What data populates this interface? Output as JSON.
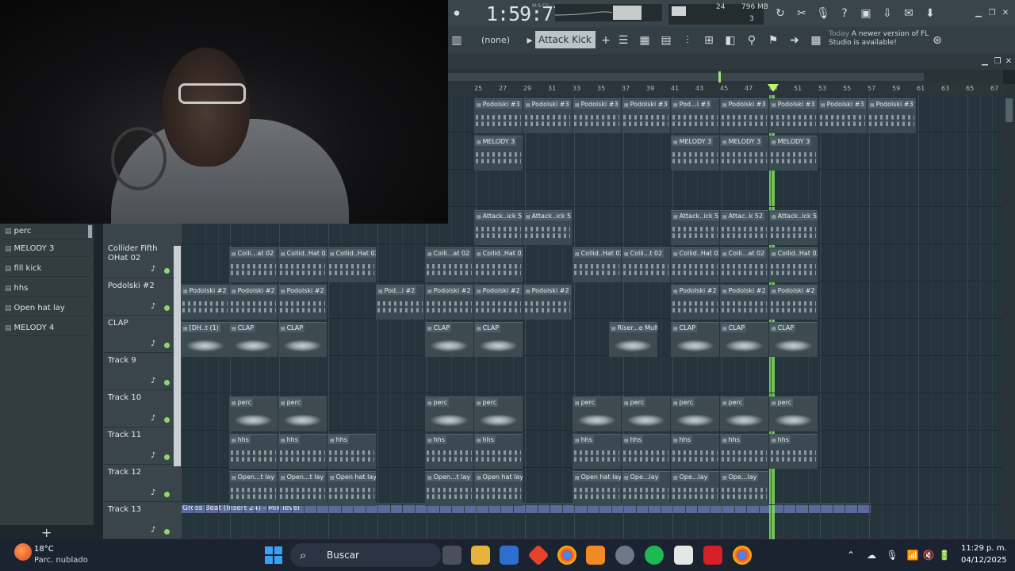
{
  "toolbar": {
    "time": "1:59:77",
    "time_sup": "M:S:CS",
    "cpu_value": "24",
    "memory": "796 MB",
    "memory_sub": "3",
    "pattern": "(none)",
    "channel": "Attack Kick 52",
    "news_today": "Today",
    "news_text": "A newer version of FL Studio is available!"
  },
  "ruler": {
    "bars": [
      "25",
      "27",
      "29",
      "31",
      "33",
      "35",
      "37",
      "39",
      "41",
      "43",
      "45",
      "47",
      "49",
      "51",
      "53",
      "55",
      "57",
      "59",
      "61",
      "63",
      "65",
      "67"
    ]
  },
  "left_panel": {
    "items": [
      "perc",
      "MELODY 3",
      "fill kick",
      "hhs",
      "Open hat lay",
      "MELODY 4"
    ],
    "add_label": "+"
  },
  "tracks": [
    {
      "name": "Collider Fifth OHat 02"
    },
    {
      "name": "Podolski #2"
    },
    {
      "name": "CLAP"
    },
    {
      "name": "Track 9"
    },
    {
      "name": "Track 10"
    },
    {
      "name": "Track 11"
    },
    {
      "name": "Track 12"
    },
    {
      "name": "Track 13"
    }
  ],
  "clips": {
    "row1": [
      "Podolski #3",
      "Podolski #3",
      "Podolski #3",
      "Podolski #3",
      "Pod...i #3",
      "Podolski #3",
      "Podolski #3",
      "Podolski #3",
      "Podolski #3"
    ],
    "row2": [
      "MELODY 3",
      "MELODY 3",
      "MELODY 3",
      "MELODY 3"
    ],
    "row4": [
      "Attack..ick 52",
      "Attack..ick 52",
      "Attack..ick 57",
      "Attac..k 52",
      "Attack..ick 52"
    ],
    "row5": [
      "Colli...at 02",
      "Collid..Hat 02",
      "Collid..Hat 02",
      "Colli...at 02",
      "Collid..Hat 02",
      "Collid..Hat 02",
      "Colli...t 02",
      "Collid..Hat 02",
      "Colli...at 02",
      "Collid..Hat 02"
    ],
    "row6": [
      "Podolski #2",
      "Podolski #2",
      "Podolski #2",
      "Pod...i #2",
      "Podolski #2",
      "Podolski #2",
      "Podolski #2",
      "Podolski #2",
      "Podolski #2",
      "Podolski #2"
    ],
    "row7": [
      "[DH..t (1)",
      "CLAP",
      "CLAP",
      "CLAP",
      "CLAP",
      "Riser...e Multi",
      "CLAP",
      "CLAP",
      "CLAP"
    ],
    "row9": [
      "perc",
      "perc",
      "perc",
      "perc",
      "perc",
      "perc",
      "perc",
      "perc",
      "perc"
    ],
    "row10": [
      "hhs",
      "hhs",
      "hhs",
      "hhs",
      "hhs",
      "hhs",
      "hhs",
      "hhs",
      "hhs",
      "hhs"
    ],
    "row11": [
      "Open...t lay",
      "Open...t lay",
      "Open hat lay",
      "Open...t lay",
      "Open hat lay",
      "Open hat lay",
      "Ope...lay",
      "Ope...lay",
      "Ope...lay"
    ],
    "automation": "Gross Beat (Insert 24) - Mix level"
  },
  "taskbar": {
    "weather_temp": "18°C",
    "weather_desc": "Parc. nublado",
    "search_placeholder": "Buscar",
    "time": "11:29 p. m.",
    "date": "04/12/2025"
  },
  "colors": {
    "playhead": "#7fdc5b",
    "clip_bg": "#3a4a51",
    "accent_green": "#8bd96b",
    "automation": "#5a6a9a"
  }
}
